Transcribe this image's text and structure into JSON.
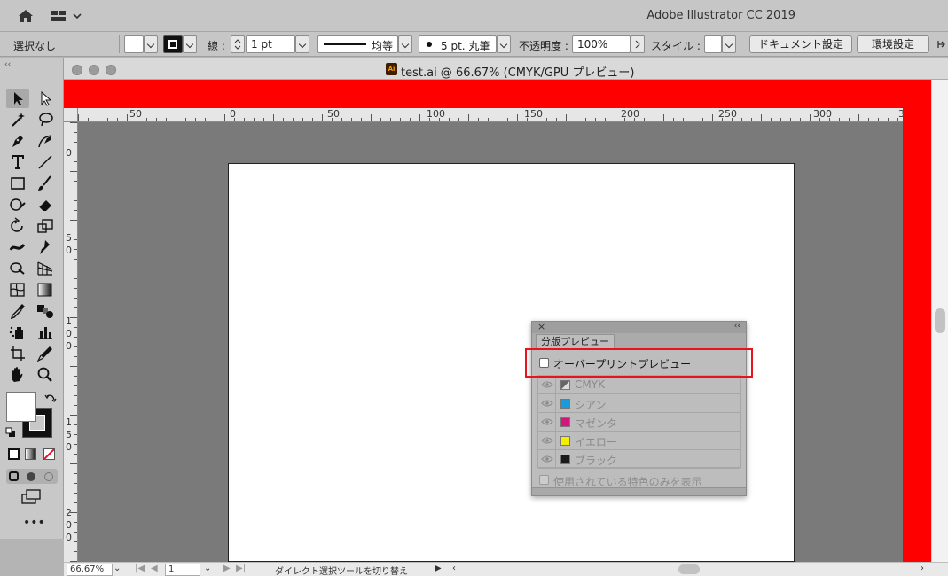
{
  "app": {
    "title": "Adobe Illustrator CC 2019",
    "home_icon": "home-icon",
    "workspace_icon": "workspace-switcher-icon"
  },
  "control_bar": {
    "selection_label": "選択なし",
    "stroke_label": "線 :",
    "stroke_weight": "1 pt",
    "line_style_label": "均等",
    "brush_label": "5 pt. 丸筆",
    "opacity_label": "不透明度 :",
    "opacity_value": "100%",
    "style_label": "スタイル :",
    "doc_setup_button": "ドキュメント設定",
    "prefs_button": "環境設定"
  },
  "document": {
    "tab_title": "test.ai @ 66.67% (CMYK/GPU プレビュー)",
    "file_icon_text": "Ai",
    "ruler_h_labels": [
      "50",
      "0",
      "50",
      "100",
      "150",
      "200",
      "250",
      "300",
      "3"
    ],
    "ruler_v_labels": [
      "0",
      "5",
      "0",
      "1",
      "0",
      "0",
      "1",
      "5",
      "0",
      "2",
      "0",
      "0"
    ]
  },
  "status_bar": {
    "zoom": "66.67%",
    "artboard_number": "1",
    "current_tool": "ダイレクト選択ツールを切り替え"
  },
  "separations_panel": {
    "tab_label": "分版プレビュー",
    "overprint_label": "オーバープリントプレビュー",
    "inks": [
      {
        "name": "CMYK",
        "color": "#8c8c8c"
      },
      {
        "name": "シアン",
        "color": "#1a9ad6"
      },
      {
        "name": "マゼンタ",
        "color": "#d4157d"
      },
      {
        "name": "イエロー",
        "color": "#f4ee00"
      },
      {
        "name": "ブラック",
        "color": "#1a1a1a"
      }
    ],
    "show_used_spot_label": "使用されている特色のみを表示",
    "highlight_color": "#e8141b"
  },
  "colors": {
    "canvas_bleed": "#ff0000",
    "panel_bg": "#bdbdbd"
  }
}
